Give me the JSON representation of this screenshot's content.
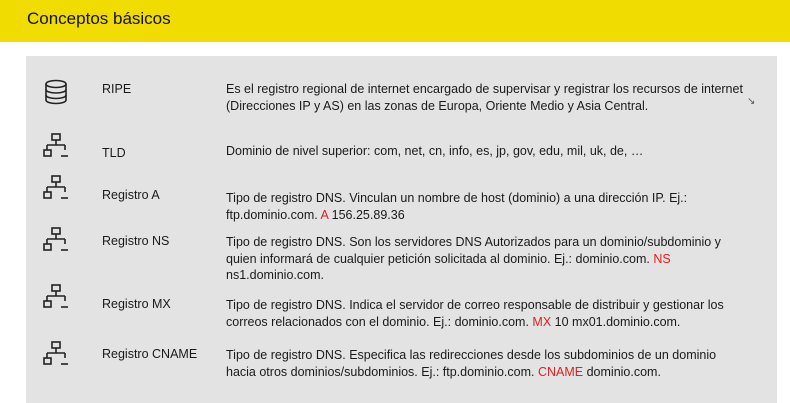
{
  "header": {
    "title": "Conceptos básicos"
  },
  "concepts": [
    {
      "icon": "database-icon",
      "term": "RIPE",
      "desc": "Es el registro regional de internet encargado de supervisar y registrar los recursos de internet (Direcciones IP y AS) en las zonas de Europa, Oriente Medio y Asia Central.",
      "example_prefix": "",
      "record_type": "",
      "example_suffix": ""
    },
    {
      "icon": "network-tree-icon",
      "term": "TLD",
      "desc": "Dominio de nivel superior: com, net, cn, info, es, jp, gov, edu, mil, uk, de, …",
      "example_prefix": "",
      "record_type": "",
      "example_suffix": ""
    },
    {
      "icon": "network-tree-icon",
      "term": "Registro A",
      "desc": "Tipo de registro DNS. Vinculan un nombre de host (dominio) a una dirección IP. Ej.:",
      "example_prefix": "ftp.dominio.com.",
      "record_type": "A",
      "example_suffix": "156.25.89.36"
    },
    {
      "icon": "network-tree-icon",
      "term": "Registro NS",
      "desc": "Tipo de registro DNS. Son los servidores DNS Autorizados para un dominio/subdominio y quien informará de cualquier petición solicitada al dominio. Ej.: dominio.com.",
      "example_prefix": "",
      "record_type": "NS",
      "example_suffix": "ns1.dominio.com."
    },
    {
      "icon": "network-tree-icon",
      "term": "Registro MX",
      "desc": "Tipo de registro DNS. Indica el servidor de correo responsable de distribuir y gestionar los correos relacionados con el dominio. Ej.: dominio.com.",
      "example_prefix": "",
      "record_type": "MX",
      "example_suffix": "10 mx01.dominio.com."
    },
    {
      "icon": "network-tree-icon",
      "term": "Registro CNAME",
      "desc": "Tipo de registro DNS. Especifica las redirecciones desde los subdominios de un dominio hacia otros dominios/subdominios. Ej.: ftp.dominio.com.",
      "example_prefix": "",
      "record_type": "CNAME",
      "example_suffix": "dominio.com."
    }
  ],
  "colors": {
    "header_bg": "#f0dc00",
    "panel_bg": "#e3e3e3",
    "record_type": "#e02020"
  }
}
